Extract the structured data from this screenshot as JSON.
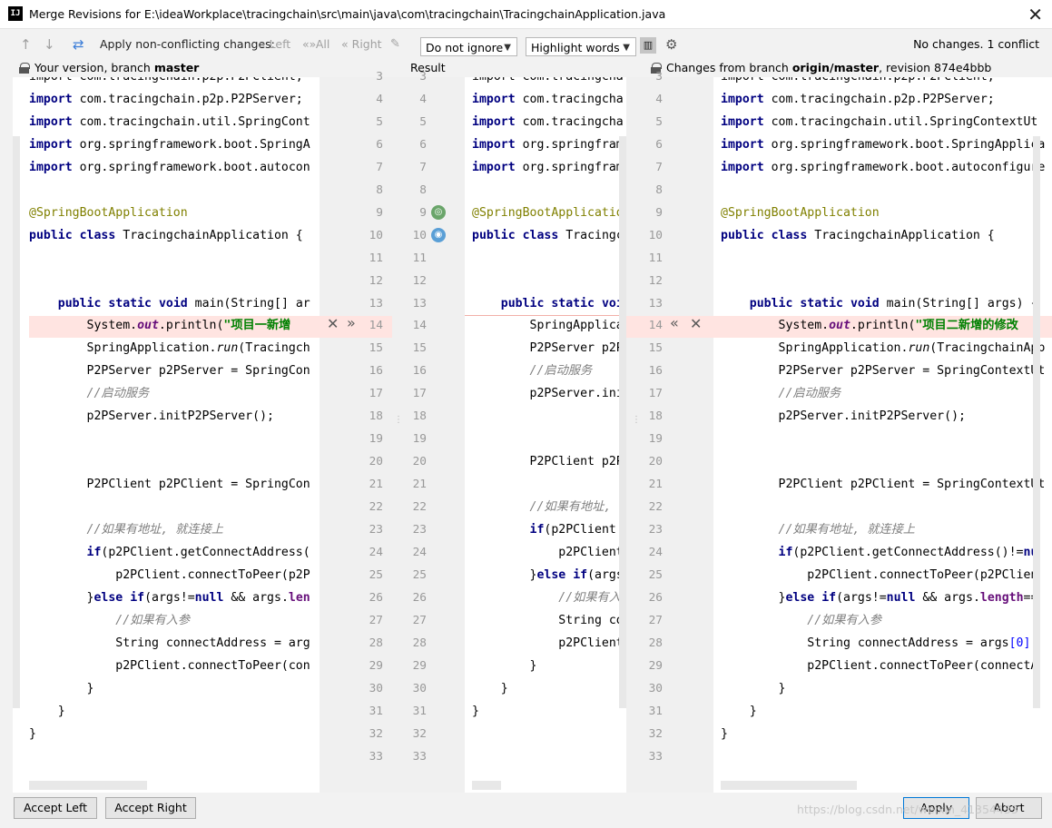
{
  "window": {
    "title": "Merge Revisions for E:\\ideaWorkplace\\tracingchain\\src\\main\\java\\com\\tracingchain\\TracingchainApplication.java",
    "app_icon": "IJ"
  },
  "toolbar": {
    "apply_nonconflicting_label": "Apply non-conflicting changes:",
    "left_label": "Left",
    "all_label": "All",
    "right_label": "Right",
    "whitespace_select": "Do not ignore",
    "highlight_select": "Highlight words",
    "status": "No changes. 1 conflict"
  },
  "headers": {
    "left_prefix": "Your version, branch ",
    "left_branch": "master",
    "center": "Result",
    "right_prefix": "Changes from branch ",
    "right_branch": "origin/master",
    "right_suffix": ", revision 874e4bbb"
  },
  "gutter_left_numbers": "3\n4\n5\n6\n7\n8\n9\n10\n11\n12\n13\n14\n15\n16\n17\n18\n19\n20\n21\n22\n23\n24\n25\n26\n27\n28\n29\n30\n31\n32\n33",
  "gutter_right_numbers": "3\n4\n5\n6\n7\n8\n9\n10\n11\n12\n13\n14\n15\n16\n17\n18\n19\n20\n21\n22\n23\n24\n25\n26\n27\n28\n29\n30\n31\n32\n33",
  "code": {
    "left": {
      "l3": "import com.tracingchain.p2p.P2PClient;",
      "l4": "com.tracingchain.p2p.P2PServer;",
      "l5": "com.tracingchain.util.SpringCont",
      "l6": "org.springframework.boot.SpringA",
      "l7": "org.springframework.boot.autocon",
      "l9": "@SpringBootApplication",
      "l10": "TracingchainApplication {",
      "l13": "main(String[] ar",
      "l14_pre": "        System.",
      "l14_out": "out",
      "l14_mid": ".println(",
      "l14_str": "\"项目一新增",
      "l15_pre": "        SpringApplication.",
      "l15_run": "run",
      "l15_post": "(Tracingch",
      "l16": "        P2PServer p2PServer = SpringCon",
      "l17": "        //启动服务",
      "l18": "        p2PServer.initP2PServer();",
      "l21": "        P2PClient p2PClient = SpringCon",
      "l23": "        //如果有地址, 就连接上",
      "l24": "(p2PClient.getConnectAddress(",
      "l25": "            p2PClient.connectToPeer(p2P",
      "l26_mid": "(args!=",
      "l26_post": " && args.",
      "l26_len": "len",
      "l27": "            //如果有入参",
      "l28": "            String connectAddress = arg",
      "l29": "            p2PClient.connectToPeer(con",
      "l30": "        }",
      "l31": "    }",
      "l32": "}"
    },
    "center": {
      "l3": "import com.tracingcha",
      "l4": "com.tracingcha",
      "l5": "com.tracingcha",
      "l6": "org.springfram",
      "l7": "org.springfram",
      "l9": "@SpringBootApplication",
      "l10": "Tracingch",
      "l13": "voi",
      "l14": "        SpringApplica",
      "l15": "        P2PServer p2P",
      "l16": "        //启动服务",
      "l17": "        p2PServer.ini",
      "l20": "        P2PClient p2P",
      "l22": "        //如果有地址,",
      "l23": "(p2PClient.g",
      "l24": "            p2PClient.",
      "l25_mid": "(args",
      "l26": "            //如果有入",
      "l27": "            String co",
      "l28": "            p2PClient.",
      "l29": "        }",
      "l30": "    }",
      "l31": "}"
    },
    "right": {
      "l3": "import com.tracingchain.p2p.P2PClient;",
      "l4": "com.tracingchain.p2p.P2PServer;",
      "l5": "com.tracingchain.util.SpringContextUt",
      "l6": "org.springframework.boot.SpringApplica",
      "l7": "org.springframework.boot.autoconfigure",
      "l9": "@SpringBootApplication",
      "l10": "TracingchainApplication {",
      "l13": "main(String[] args) {",
      "l14_pre": "        System.",
      "l14_out": "out",
      "l14_mid": ".println(",
      "l14_str": "\"项目二新增的修改",
      "l15_pre": "        SpringApplication.",
      "l15_run": "run",
      "l15_post": "(TracingchainApp",
      "l16": "        P2PServer p2PServer = SpringContextUt",
      "l17": "        //启动服务",
      "l18": "        p2PServer.initP2PServer();",
      "l21": "        P2PClient p2PClient = SpringContextUt",
      "l23": "        //如果有地址, 就连接上",
      "l24": "(p2PClient.getConnectAddress()!=",
      "l24_nu": "nu",
      "l25": "            p2PClient.connectToPeer(p2PClien",
      "l26_mid": "(args!=",
      "l26_post": " && args.",
      "l26_len": "length",
      "l26_end": "==",
      "l27": "            //如果有入参",
      "l28_pre": "            String connectAddress = args",
      "l28_idx": "[0]",
      "l28_end": ";",
      "l29": "            p2PClient.connectToPeer(connectA",
      "l30": "        }",
      "l31": "    }",
      "l32": "}"
    },
    "kw_import": "import",
    "kw_public": "public",
    "kw_class": "class",
    "kw_static": "static",
    "kw_void": "void",
    "kw_if": "if",
    "kw_else": "else",
    "kw_null": "null"
  },
  "buttons": {
    "accept_left": "Accept Left",
    "accept_right": "Accept Right",
    "apply": "Apply",
    "abort": "Abort"
  },
  "watermark": "https://blog.csdn.net/weixin_41354433",
  "colors": {
    "conflict_bg": "#ffe4e1",
    "keyword": "#000080",
    "annotation": "#808000",
    "string": "#008000"
  }
}
